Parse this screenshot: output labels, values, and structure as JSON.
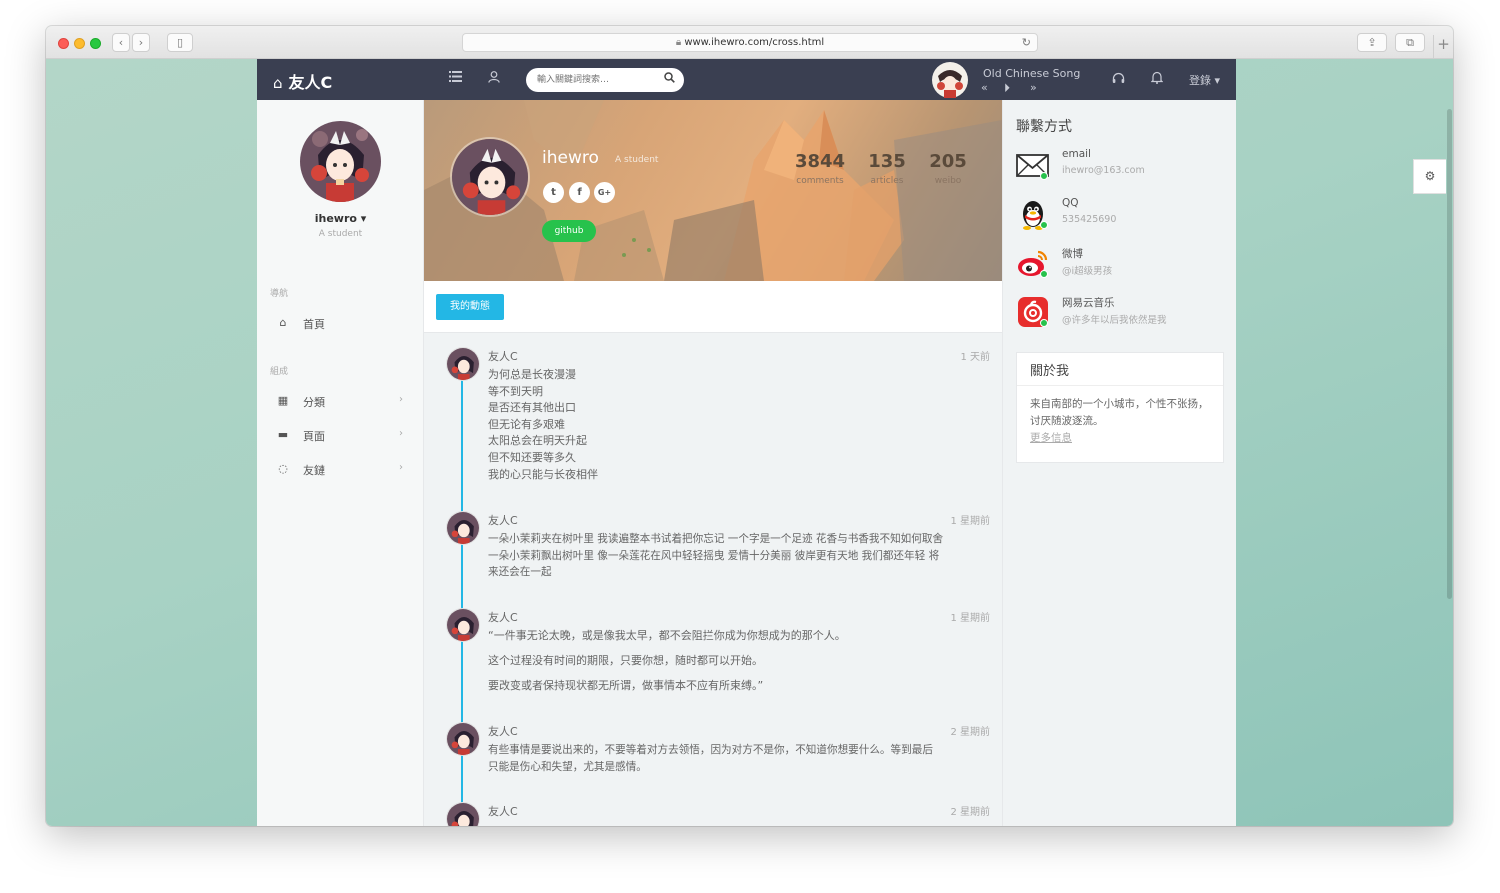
{
  "browser": {
    "url": "www.ihewro.com/cross.html",
    "sidebar_toggle": "▯",
    "back": "‹",
    "forward": "›",
    "reload": "↻",
    "share": "⇪",
    "tabs": "⧉",
    "new_tab": "+"
  },
  "header": {
    "brand": "友人C",
    "home_icon": "⌂",
    "search_placeholder": "輸入關鍵詞搜索…",
    "music": {
      "title": "Old Chinese Song",
      "prev": "«",
      "play": "⏵",
      "next": "»"
    },
    "login": "登錄 ▾"
  },
  "sidebar": {
    "name": "ihewro ▾",
    "subtitle": "A student",
    "nav_label": "導航",
    "compose_label": "組成",
    "items": [
      {
        "label": "首頁",
        "icon": "⌂"
      },
      {
        "label": "分類",
        "icon": "▦"
      },
      {
        "label": "頁面",
        "icon": "▬"
      },
      {
        "label": "友鏈",
        "icon": "◌"
      }
    ],
    "arrow": "›"
  },
  "profile": {
    "name": "ihewro",
    "role": "A student",
    "social": [
      "t",
      "f",
      "G+"
    ],
    "github": "github",
    "stats": [
      {
        "num": "3844",
        "label": "comments"
      },
      {
        "num": "135",
        "label": "articles"
      },
      {
        "num": "205",
        "label": "weibo"
      }
    ]
  },
  "tab": {
    "label": "我的動態"
  },
  "posts": [
    {
      "author": "友人C",
      "time": "1 天前",
      "lines": [
        "为何总是长夜漫漫",
        "等不到天明",
        "是否还有其他出口",
        "但无论有多艰难",
        "太阳总会在明天升起",
        "但不知还要等多久",
        "我的心只能与长夜相伴"
      ]
    },
    {
      "author": "友人C",
      "time": "1 星期前",
      "lines": [
        "一朵小茉莉夹在树叶里 我读遍整本书试着把你忘记 一个字是一个足迹 花香与书香我不知如何取舍",
        "一朵小茉莉飘出树叶里 像一朵莲花在风中轻轻摇曳 爱情十分美丽 彼岸更有天地 我们都还年轻 将",
        "来还会在一起"
      ]
    },
    {
      "author": "友人C",
      "time": "1 星期前",
      "lines": [
        "“一件事无论太晚，或是像我太早，都不会阻拦你成为你想成为的那个人。",
        "这个过程没有时间的期限，只要你想，随时都可以开始。",
        "要改变或者保持现状都无所谓，做事情本不应有所束缚。”"
      ]
    },
    {
      "author": "友人C",
      "time": "2 星期前",
      "lines": [
        "有些事情是要说出来的，不要等着对方去领悟，因为对方不是你，不知道你想要什么。等到最后",
        "只能是伤心和失望，尤其是感情。"
      ]
    },
    {
      "author": "友人C",
      "time": "2 星期前",
      "lines": []
    }
  ],
  "contacts": {
    "title": "聯繫方式",
    "items": [
      {
        "label": "email",
        "value": "ihewro@163.com"
      },
      {
        "label": "QQ",
        "value": "535425690"
      },
      {
        "label": "微博",
        "value": "@i超级男孩"
      },
      {
        "label": "网易云音乐",
        "value": "@许多年以后我依然是我"
      }
    ]
  },
  "about": {
    "title": "關於我",
    "text": "来自南部的一个小城市，个性不张扬，讨厌随波逐流。",
    "more": "更多信息"
  },
  "settings_icon": "⚙",
  "colors": {
    "navbar": "#3a3f51",
    "accent": "#23b7e5",
    "github": "#27c24c",
    "online": "#27c24c"
  }
}
